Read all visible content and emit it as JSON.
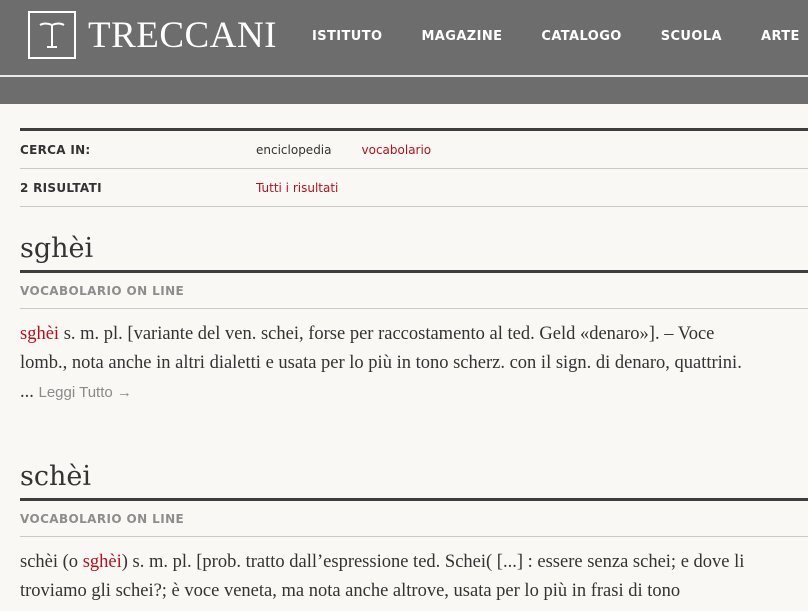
{
  "header": {
    "brand": "TRECCANI",
    "nav": [
      "ISTITUTO",
      "MAGAZINE",
      "CATALOGO",
      "SCUOLA",
      "ARTE"
    ]
  },
  "search": {
    "label": "CERCA IN:",
    "options": [
      "enciclopedia",
      "vocabolario"
    ],
    "active_option": "vocabolario",
    "results_label": "2 RISULTATI",
    "all_results": "Tutti i risultati"
  },
  "entries": [
    {
      "title": "sghèi",
      "source": "VOCABOLARIO ON LINE",
      "lines": [
        [
          "sghèi",
          " s. m. pl. [variante del ven. schei, forse per raccostamento al ted. Geld «denaro»]. – Voce"
        ],
        [
          "",
          "lomb., nota anche in altri dialetti e usata per lo più in tono scherz. con il sign. di denaro, quattrini."
        ]
      ],
      "ellipsis": "...",
      "read_more": "Leggi Tutto →"
    },
    {
      "title": "schèi",
      "source": "VOCABOLARIO ON LINE",
      "line1_pre": "schèi (o ",
      "line1_kw": "sghèi",
      "line1_post": ") s. m. pl. [prob. tratto dall’espressione ted. Schei( [...] : essere senza schei; e dove li",
      "line2": "troviamo gli schei?; è voce veneta, ma nota anche altrove, usata per lo più in frasi di tono"
    }
  ],
  "colors": {
    "header_bg": "#6d6d6d",
    "accent": "#b3121c"
  }
}
